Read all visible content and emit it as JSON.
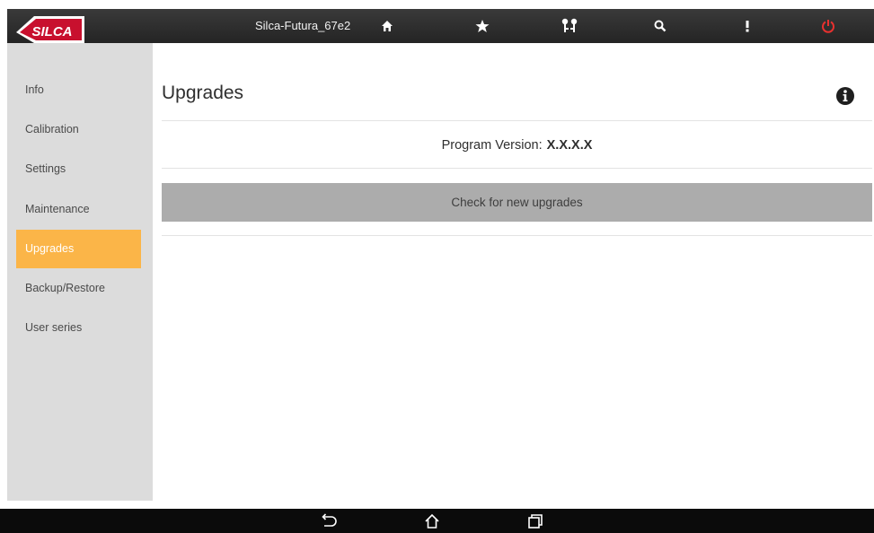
{
  "header": {
    "logo_text": "SILCA",
    "device_name": "Silca-Futura_67e2",
    "icons": [
      "home-icon",
      "star-icon",
      "keys-icon",
      "search-icon",
      "more-icon",
      "power-icon"
    ],
    "power_color": "#e8312f"
  },
  "sidebar": {
    "accent_color": "#fbb548",
    "items": [
      {
        "label": "Info",
        "active": false
      },
      {
        "label": "Calibration",
        "active": false
      },
      {
        "label": "Settings",
        "active": false
      },
      {
        "label": "Maintenance",
        "active": false
      },
      {
        "label": "Upgrades",
        "active": true
      },
      {
        "label": "Backup/Restore",
        "active": false
      },
      {
        "label": "User series",
        "active": false
      }
    ]
  },
  "main": {
    "title": "Upgrades",
    "version_label": "Program Version:",
    "version_value": "X.X.X.X",
    "check_button_label": "Check for new upgrades"
  },
  "navbar": {
    "icons": [
      "back-icon",
      "home-outline-icon",
      "recent-apps-icon"
    ]
  }
}
